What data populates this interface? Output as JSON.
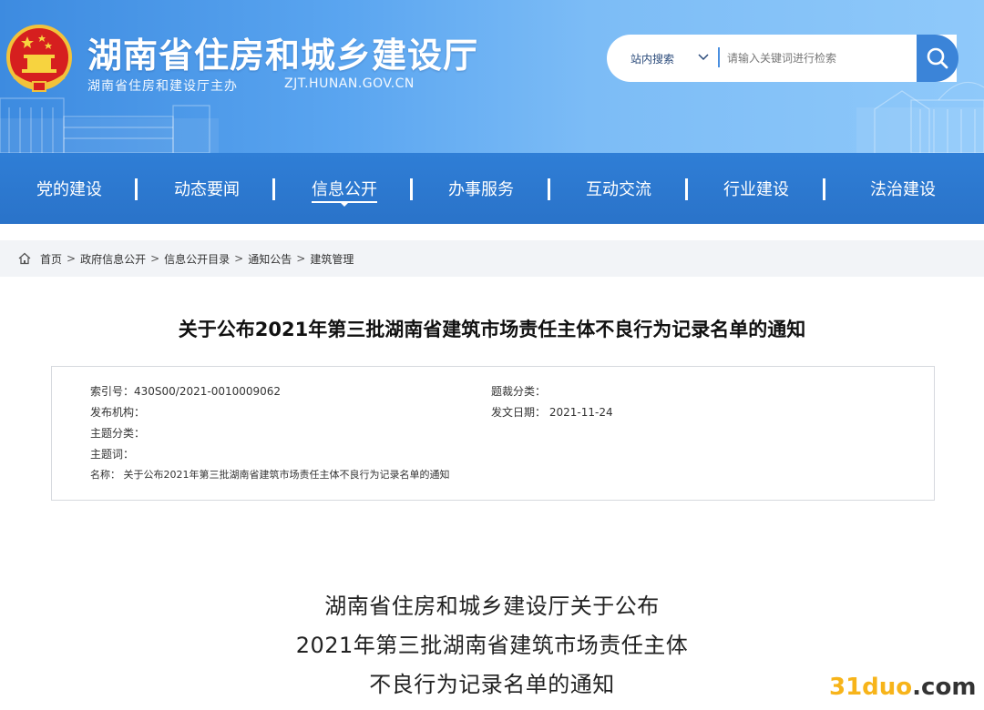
{
  "header": {
    "title": "湖南省住房和城乡建设厅",
    "subtitle": "湖南省住房和建设厅主办",
    "domain": "ZJT.HUNAN.GOV.CN",
    "emblem_icon": "national-emblem-icon"
  },
  "search": {
    "scope_label": "站内搜索",
    "placeholder": "请输入关键词进行检索",
    "button_icon": "search-icon"
  },
  "nav": {
    "items": [
      {
        "label": "党的建设"
      },
      {
        "label": "动态要闻"
      },
      {
        "label": "信息公开",
        "active": true
      },
      {
        "label": "办事服务"
      },
      {
        "label": "互动交流"
      },
      {
        "label": "行业建设"
      },
      {
        "label": "法治建设"
      }
    ]
  },
  "breadcrumb": {
    "items": [
      "首页",
      "政府信息公开",
      "信息公开目录",
      "通知公告",
      "建筑管理"
    ],
    "separator": ">"
  },
  "article": {
    "title": "关于公布2021年第三批湖南省建筑市场责任主体不良行为记录名单的通知",
    "meta": {
      "index_label": "索引号：",
      "index_value": "430S00/2021-0010009062",
      "genre_label": "题裁分类：",
      "genre_value": "",
      "publisher_label": "发布机构：",
      "publisher_value": "",
      "date_label": "发文日期：",
      "date_value": "2021-11-24",
      "topic_label": "主题分类：",
      "topic_value": "",
      "keywords_label": "主题词：",
      "keywords_value": "",
      "name_label": "名称：",
      "name_value": "关于公布2021年第三批湖南省建筑市场责任主体不良行为记录名单的通知"
    },
    "heading_lines": [
      "湖南省住房和城乡建设厅关于公布",
      "2021年第三批湖南省建筑市场责任主体",
      "不良行为记录名单的通知"
    ]
  },
  "watermark": {
    "text": "31duo",
    "suffix": ".com"
  },
  "colors": {
    "header_blue": "#3d8be0",
    "nav_blue": "#2f7ed6",
    "search_button": "#3b84d8",
    "watermark": "#f7b41a"
  }
}
